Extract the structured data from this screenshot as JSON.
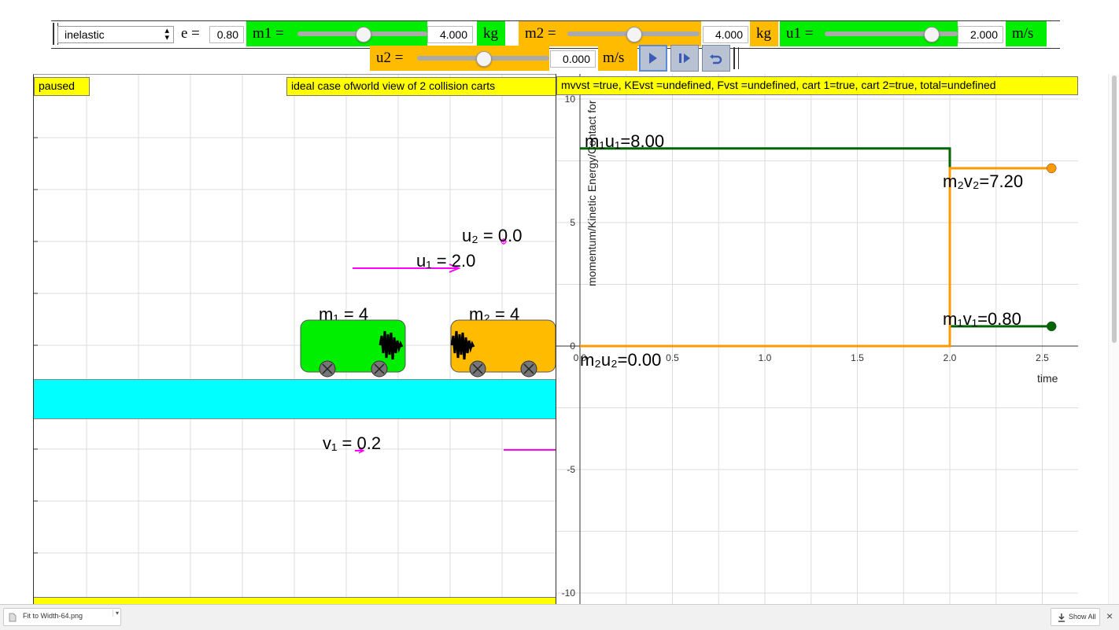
{
  "controls": {
    "collision_type": "inelastic",
    "e_label": "e =",
    "e_value": "0.80",
    "m1_label": "m1 =",
    "m1_value": "4.000",
    "m1_unit": "kg",
    "m1_level": 0.5,
    "m2_label": "m2 =",
    "m2_value": "4.000",
    "m2_unit": "kg",
    "m2_level": 0.5,
    "u1_label": "u1 =",
    "u1_value": "2.000",
    "u1_unit": "m/s",
    "u1_level": 0.8,
    "u2_label": "u2 =",
    "u2_value": "0.000",
    "u2_unit": "m/s",
    "u2_level": 0.5
  },
  "world": {
    "status": "paused",
    "title": "ideal case ofworld view of 2 collision carts",
    "u2_label": "u₂ = 0.0",
    "u1_label": "u₁ = 2.0",
    "m1_label": "m₁ = 4",
    "m2_label": "m₂ = 4",
    "v1_label": "v₁ = 0.2",
    "colors": {
      "cart1": "#00ee00",
      "cart2": "#ffbb00",
      "track": "#00ffff",
      "vector": "#ff00ff"
    }
  },
  "graph": {
    "status_line": "mvvst =true, KEvst =undefined, Fvst =undefined, cart 1=true, cart 2=true, total=undefined",
    "ylabel": "momentum/Kinetic Energy/Contact for",
    "xlabel": "time",
    "y_ticks": [
      "10",
      "5",
      "0",
      "-5",
      "-10"
    ],
    "x_ticks": [
      "0.0",
      "0.5",
      "1.0",
      "1.5",
      "2.0",
      "2.5"
    ],
    "annotations": {
      "m1u1": "m₁u₁=8.00",
      "m2v2": "m₂v₂=7.20",
      "m1v1": "m₁v₁=0.80",
      "m2u2": "m₂u₂=0.00"
    }
  },
  "chart_data": {
    "type": "line",
    "xlabel": "time",
    "ylabel": "momentum/Kinetic Energy/Contact for",
    "xlim": [
      0,
      2.7
    ],
    "ylim": [
      -10,
      10
    ],
    "series": [
      {
        "name": "cart 1",
        "color": "#006600",
        "x": [
          0,
          2.0,
          2.0,
          2.55
        ],
        "y": [
          8.0,
          8.0,
          0.8,
          0.8
        ]
      },
      {
        "name": "cart 2",
        "color": "#ff9900",
        "x": [
          0,
          2.0,
          2.0,
          2.55
        ],
        "y": [
          0.0,
          0.0,
          7.2,
          7.2
        ]
      }
    ]
  },
  "footer": {
    "file_name": "Fit to Width-64.png",
    "show_all": "Show All",
    "close": "×"
  }
}
